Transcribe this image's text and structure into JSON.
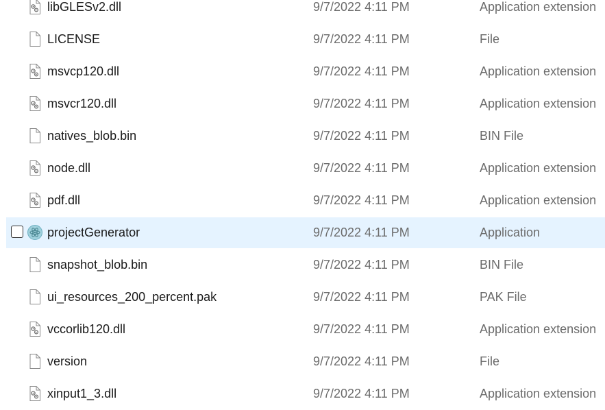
{
  "files": [
    {
      "name": "libGLESv2.dll",
      "date": "9/7/2022 4:11 PM",
      "type": "Application extension",
      "icon": "dll-file-icon",
      "selected": false
    },
    {
      "name": "LICENSE",
      "date": "9/7/2022 4:11 PM",
      "type": "File",
      "icon": "file-icon",
      "selected": false
    },
    {
      "name": "msvcp120.dll",
      "date": "9/7/2022 4:11 PM",
      "type": "Application extension",
      "icon": "dll-file-icon",
      "selected": false
    },
    {
      "name": "msvcr120.dll",
      "date": "9/7/2022 4:11 PM",
      "type": "Application extension",
      "icon": "dll-file-icon",
      "selected": false
    },
    {
      "name": "natives_blob.bin",
      "date": "9/7/2022 4:11 PM",
      "type": "BIN File",
      "icon": "file-icon",
      "selected": false
    },
    {
      "name": "node.dll",
      "date": "9/7/2022 4:11 PM",
      "type": "Application extension",
      "icon": "dll-file-icon",
      "selected": false
    },
    {
      "name": "pdf.dll",
      "date": "9/7/2022 4:11 PM",
      "type": "Application extension",
      "icon": "dll-file-icon",
      "selected": false
    },
    {
      "name": "projectGenerator",
      "date": "9/7/2022 4:11 PM",
      "type": "Application",
      "icon": "electron-app-icon",
      "selected": true
    },
    {
      "name": "snapshot_blob.bin",
      "date": "9/7/2022 4:11 PM",
      "type": "BIN File",
      "icon": "file-icon",
      "selected": false
    },
    {
      "name": "ui_resources_200_percent.pak",
      "date": "9/7/2022 4:11 PM",
      "type": "PAK File",
      "icon": "file-icon",
      "selected": false
    },
    {
      "name": "vccorlib120.dll",
      "date": "9/7/2022 4:11 PM",
      "type": "Application extension",
      "icon": "dll-file-icon",
      "selected": false
    },
    {
      "name": "version",
      "date": "9/7/2022 4:11 PM",
      "type": "File",
      "icon": "file-icon",
      "selected": false
    },
    {
      "name": "xinput1_3.dll",
      "date": "9/7/2022 4:11 PM",
      "type": "Application extension",
      "icon": "dll-file-icon",
      "selected": false
    }
  ],
  "colors": {
    "selected_row_bg": "#e5f3ff",
    "name_text": "#1a1a1a",
    "meta_text": "#6b6b6b",
    "app_icon_accent": "#47848f"
  }
}
